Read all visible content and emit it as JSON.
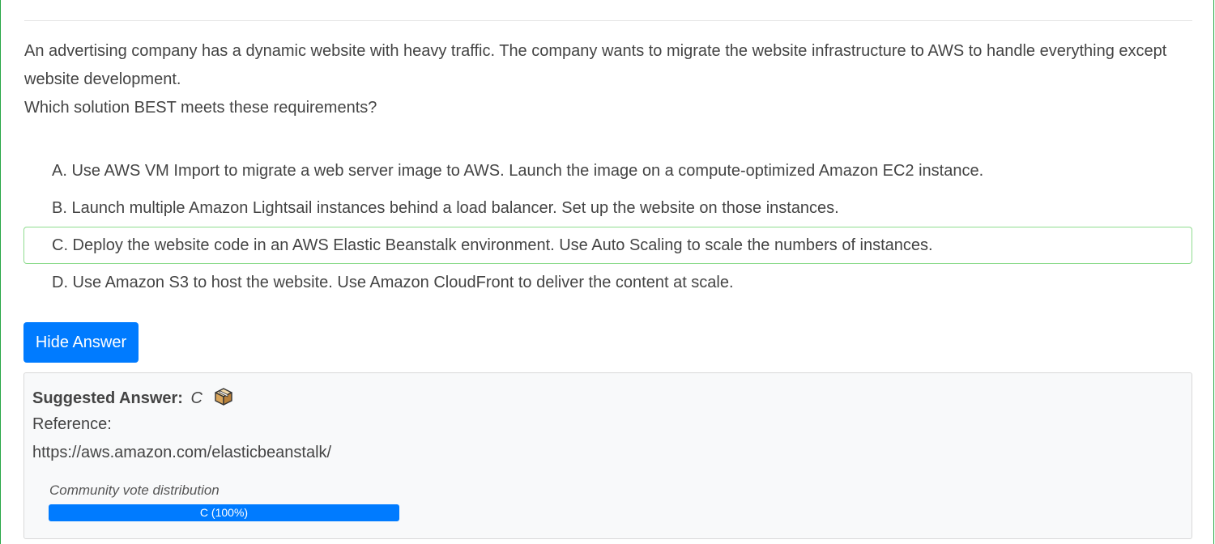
{
  "question": {
    "text": "An advertising company has a dynamic website with heavy traffic. The company wants to migrate the website infrastructure to AWS to handle everything except website development.",
    "prompt": "Which solution BEST meets these requirements?"
  },
  "choices": [
    {
      "label": "A. Use AWS VM Import to migrate a web server image to AWS. Launch the image on a compute-optimized Amazon EC2 instance.",
      "correct": false
    },
    {
      "label": "B. Launch multiple Amazon Lightsail instances behind a load balancer. Set up the website on those instances.",
      "correct": false
    },
    {
      "label": "C. Deploy the website code in an AWS Elastic Beanstalk environment. Use Auto Scaling to scale the numbers of instances.",
      "correct": true
    },
    {
      "label": "D. Use Amazon S3 to host the website. Use Amazon CloudFront to deliver the content at scale.",
      "correct": false
    }
  ],
  "hide_button": {
    "label": "Hide Answer"
  },
  "answer": {
    "suggested_label": "Suggested Answer:",
    "suggested_value": "C",
    "icon": "box-icon",
    "reference_label": "Reference:",
    "reference_url": "https://aws.amazon.com/elasticbeanstalk/"
  },
  "vote": {
    "title": "Community vote distribution",
    "bar_label": "C (100%)",
    "percent": 100
  },
  "colors": {
    "accent": "#007bff",
    "correct_border": "#8fdc8f",
    "frame": "#28a745"
  }
}
